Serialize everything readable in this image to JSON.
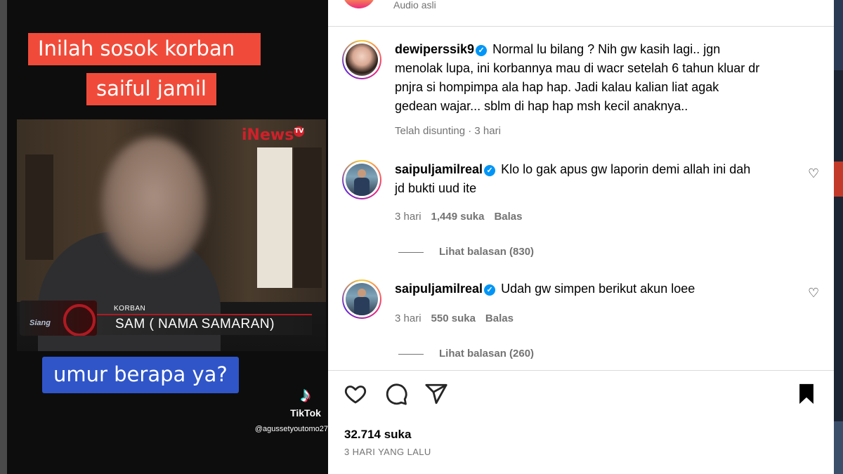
{
  "video": {
    "caption_top_line1": "Inilah sosok korban",
    "caption_top_line2": "saiful jamil",
    "caption_bottom": "umur berapa ya?",
    "broadcaster_logo": "iNews",
    "broadcaster_logo_badge": "TV",
    "show_logo_text": "Siang",
    "lower_third_label": "KORBAN",
    "lower_third_name": "SAM ( NAMA SAMARAN)",
    "tiktok_word": "TikTok",
    "tiktok_handle": "@agussetyoutomo27",
    "tiktok_icon": "tiktok-note-icon"
  },
  "post": {
    "audio_label": "Audio asli",
    "comments": [
      {
        "username": "dewiperssik9",
        "verified": true,
        "text": "Normal lu bilang ? Nih gw kasih lagi.. jgn menolak lupa, ini korbannya mau di wacr setelah 6 tahun kluar dr pnjra si hompimpa ala hap hap. Jadi kalau kalian liat agak gedean wajar... sblm di hap hap msh kecil anaknya..",
        "meta": "Telah disunting · 3 hari"
      },
      {
        "username": "saipuljamilreal",
        "verified": true,
        "text": "Klo lo gak apus gw laporin demi allah ini dah jd bukti uud ite",
        "time": "3 hari",
        "likes": "1,449 suka",
        "reply": "Balas",
        "view_replies": "Lihat balasan (830)"
      },
      {
        "username": "saipuljamilreal",
        "verified": true,
        "text": "Udah gw simpen berikut akun loee",
        "time": "3 hari",
        "likes": "550 suka",
        "reply": "Balas",
        "view_replies": "Lihat balasan (260)"
      }
    ],
    "likes_total": "32.714 suka",
    "date": "3 HARI YANG LALU",
    "icons": [
      "heart-icon",
      "comment-icon",
      "share-icon",
      "bookmark-icon"
    ]
  },
  "colors": {
    "caption_red": "#f04b3a",
    "caption_blue": "#2f55c9",
    "verified_blue": "#0095f6",
    "muted_text": "#737373"
  }
}
